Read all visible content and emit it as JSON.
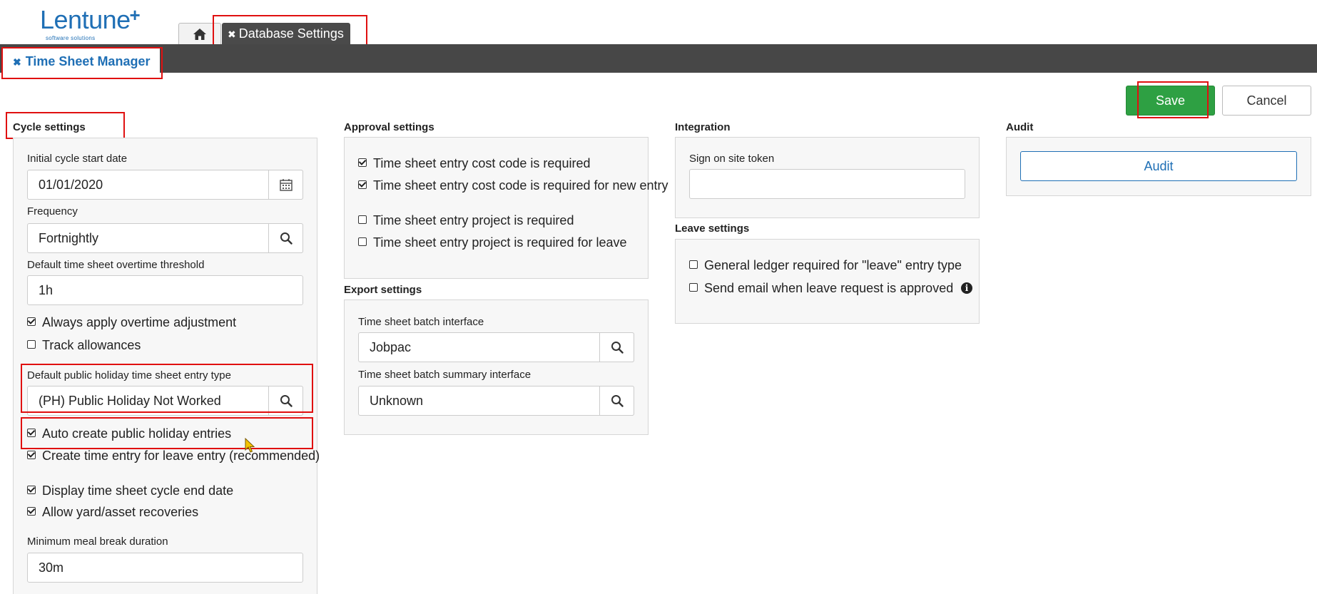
{
  "brand": {
    "name": "Lentune",
    "tagline": "software solutions"
  },
  "tabs": {
    "home_icon": "home-icon",
    "db_tab": "Database Settings",
    "close_glyph": "✖"
  },
  "module_title": "Time Sheet Manager",
  "actions": {
    "save": "Save",
    "cancel": "Cancel"
  },
  "cycle": {
    "title": "Cycle settings",
    "start_label": "Initial cycle start date",
    "start_value": "01/01/2020",
    "frequency_label": "Frequency",
    "frequency_value": "Fortnightly",
    "overtime_label": "Default time sheet overtime threshold",
    "overtime_value": "1h",
    "always_overtime": "Always apply overtime adjustment",
    "track_allowances": "Track allowances",
    "holiday_label": "Default public holiday time sheet entry type",
    "holiday_value": "(PH) Public Holiday Not Worked",
    "auto_create": "Auto create public holiday entries",
    "create_time": "Create time entry for leave entry (recommended)",
    "display_end": "Display time sheet cycle end date",
    "allow_yard": "Allow yard/asset recoveries",
    "meal_label": "Minimum meal break duration",
    "meal_value": "30m"
  },
  "approval": {
    "title": "Approval settings",
    "items": [
      "Time sheet entry cost code is required",
      "Time sheet entry cost code is required for new entry",
      "Time sheet entry project is required",
      "Time sheet entry project is required for leave"
    ]
  },
  "export": {
    "title": "Export settings",
    "batch_label": "Time sheet batch interface",
    "batch_value": "Jobpac",
    "summary_label": "Time sheet batch summary interface",
    "summary_value": "Unknown"
  },
  "integration": {
    "title": "Integration",
    "token_label": "Sign on site token",
    "token_value": ""
  },
  "leave": {
    "title": "Leave settings",
    "gl_required": "General ledger required for \"leave\" entry type",
    "send_email": "Send email when leave request is approved",
    "info_glyph": "i"
  },
  "audit": {
    "title": "Audit",
    "button": "Audit"
  }
}
